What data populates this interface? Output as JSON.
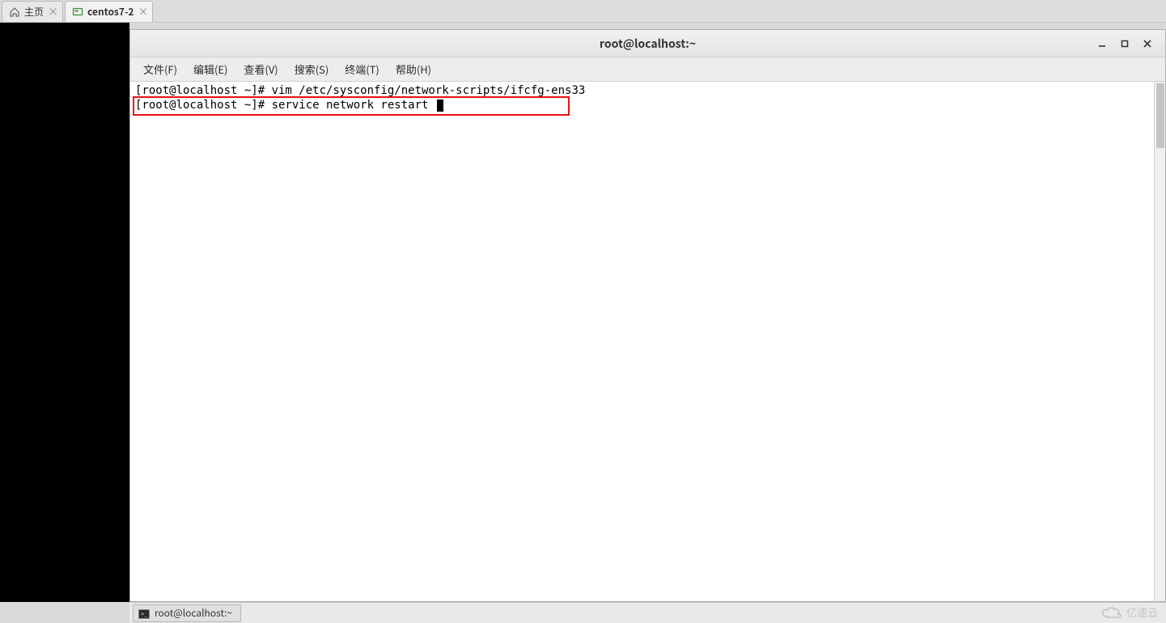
{
  "tabs": [
    {
      "label": "主页",
      "active": false
    },
    {
      "label": "centos7-2",
      "active": true
    }
  ],
  "window": {
    "title": "root@localhost:~"
  },
  "menu": {
    "file": "文件(F)",
    "edit": "编辑(E)",
    "view": "查看(V)",
    "search": "搜索(S)",
    "terminal": "终端(T)",
    "help": "帮助(H)"
  },
  "terminal": {
    "line1": "[root@localhost ~]# vim /etc/sysconfig/network-scripts/ifcfg-ens33",
    "line2": "[root@localhost ~]# service network restart"
  },
  "taskbar": {
    "item1": "root@localhost:~"
  },
  "watermark": "亿速云"
}
